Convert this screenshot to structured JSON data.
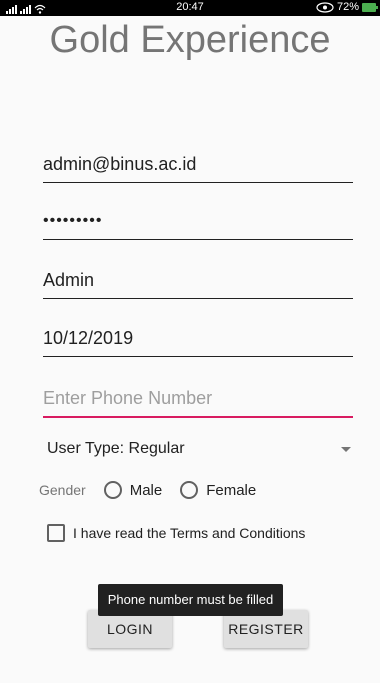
{
  "status_bar": {
    "time": "20:47",
    "battery": "72%"
  },
  "app": {
    "title": "Gold Experience"
  },
  "form": {
    "email": "admin@binus.ac.id",
    "password_masked": "•••••••••",
    "username": "Admin",
    "dob": "10/12/2019",
    "phone": "",
    "phone_placeholder": "Enter Phone Number",
    "user_type": "User Type: Regular",
    "gender_label": "Gender",
    "gender_options": [
      "Male",
      "Female"
    ],
    "terms": "I have read the Terms and Conditions"
  },
  "buttons": {
    "login": "LOGIN",
    "register": "REGISTER"
  },
  "toast": {
    "message": "Phone number must be filled"
  },
  "colors": {
    "accent": "#d81b60",
    "battery": "#4caf50"
  }
}
